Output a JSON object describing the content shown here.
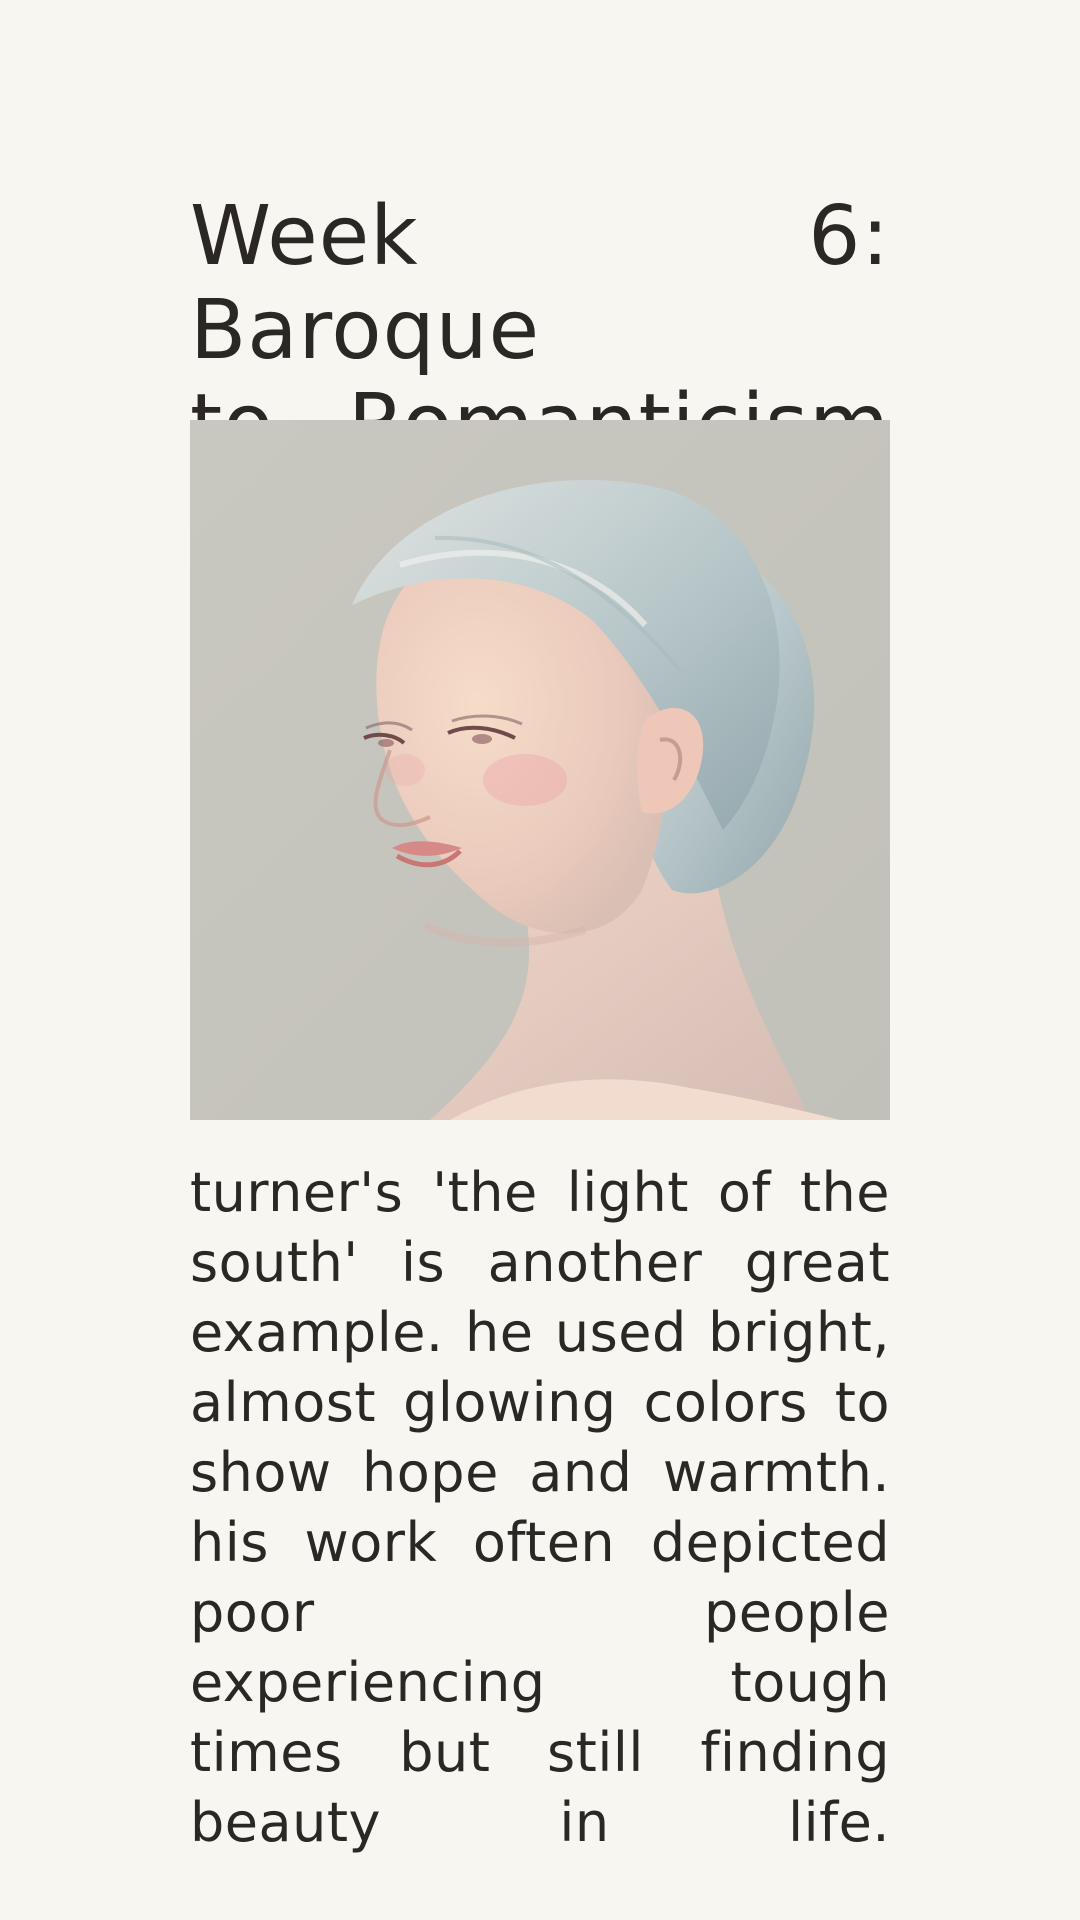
{
  "slide": {
    "title": "Week 6: Baroque to Romanticism",
    "title_line_1": "Week 6: Baroque",
    "title_line_2": "to Romanticism",
    "image": {
      "icon": "portrait-illustration-icon"
    },
    "body": "turner's 'the light of the south' is another great example. he used bright, almost glowing colors to show hope and warmth. his work often depicted poor people experiencing tough times but still finding beauty in life."
  },
  "colors": {
    "background": "#f8f6f0",
    "text": "#2b2724",
    "image_background": "#c8c7bf"
  }
}
